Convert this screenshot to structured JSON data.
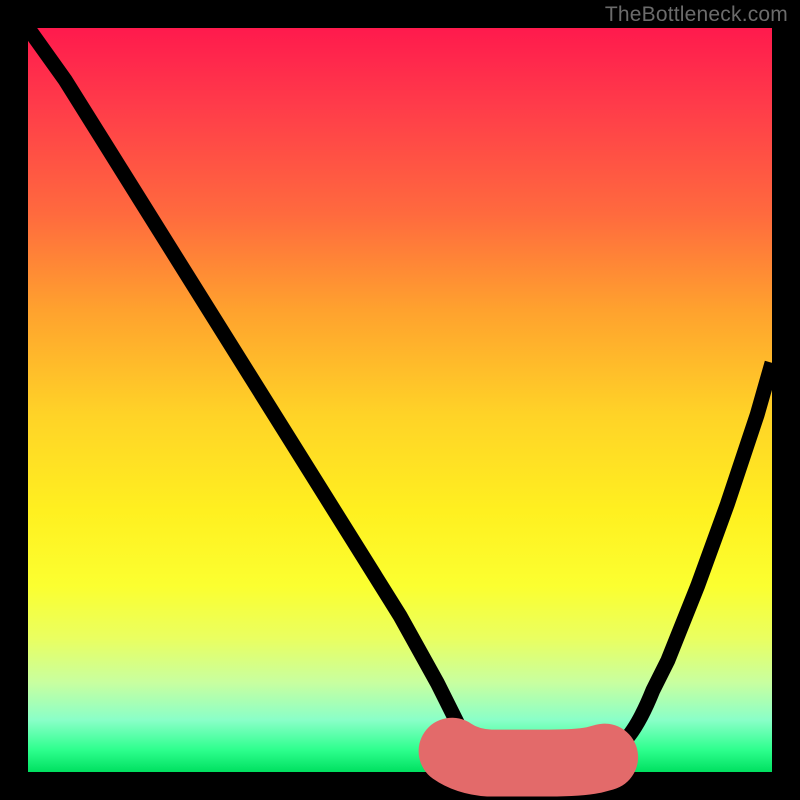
{
  "watermark": "TheBottleneck.com",
  "chart_data": {
    "type": "line",
    "title": "",
    "xlabel": "",
    "ylabel": "",
    "xlim": [
      0,
      100
    ],
    "ylim": [
      0,
      100
    ],
    "background_gradient": {
      "top": "#ff1a4d",
      "mid": "#fff020",
      "bottom": "#00e060"
    },
    "series": [
      {
        "name": "bottleneck-curve",
        "color": "#000000",
        "x": [
          0,
          5,
          10,
          15,
          20,
          25,
          30,
          35,
          40,
          45,
          50,
          55,
          58,
          62,
          66,
          70,
          74,
          78,
          82,
          86,
          90,
          94,
          98,
          100
        ],
        "values": [
          100,
          93,
          85,
          77,
          69,
          61,
          53,
          45,
          37,
          29,
          21,
          12,
          6,
          2,
          1,
          1,
          1,
          2,
          6,
          15,
          25,
          36,
          48,
          55
        ]
      },
      {
        "name": "optimal-zone",
        "color": "#e36a6a",
        "x": [
          57,
          60,
          63,
          66,
          69,
          72,
          75,
          78
        ],
        "values": [
          2,
          1,
          1,
          1,
          1,
          1,
          1,
          2
        ]
      }
    ],
    "annotations": [
      {
        "name": "optimal-zone-end-marker",
        "x": 78,
        "y": 2,
        "color": "#e36a6a"
      }
    ]
  }
}
